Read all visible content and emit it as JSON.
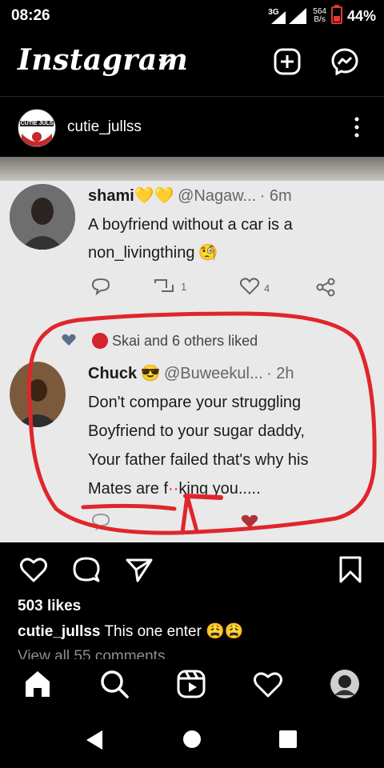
{
  "status_bar": {
    "time": "08:26",
    "network": "3G",
    "speed_value": "564",
    "speed_unit": "B/s",
    "battery": "44%"
  },
  "header": {
    "logo": "Instagram"
  },
  "post": {
    "username": "cutie_jullss",
    "avatar_text": "CUTIE JULS",
    "image": {
      "tweet1": {
        "name": "shami",
        "handle": "@Nagaw...",
        "time": "· 6m",
        "text_line1": "A boyfriend without a car is a",
        "text_line2": "non_livingthing",
        "retweets": "1",
        "likes": "4"
      },
      "liked_by": "Skai and 6 others liked",
      "tweet2": {
        "name": "Chuck",
        "handle": "@Buweekul...",
        "time": "· 2h",
        "line1": "Don't compare your struggling",
        "line2": "Boyfriend to your sugar daddy,",
        "line3": "Your father failed that's why his",
        "line4": "Mates are f",
        "line4b": "king you....."
      }
    },
    "likes": "503 likes",
    "caption_user": "cutie_jullss",
    "caption_text": "This one enter",
    "view_comments": "View all 55 comments"
  },
  "colors": {
    "background": "#000000",
    "annotation_red": "#e0262b",
    "battery_red": "#e53935",
    "gray_text": "#8e8e8e"
  }
}
